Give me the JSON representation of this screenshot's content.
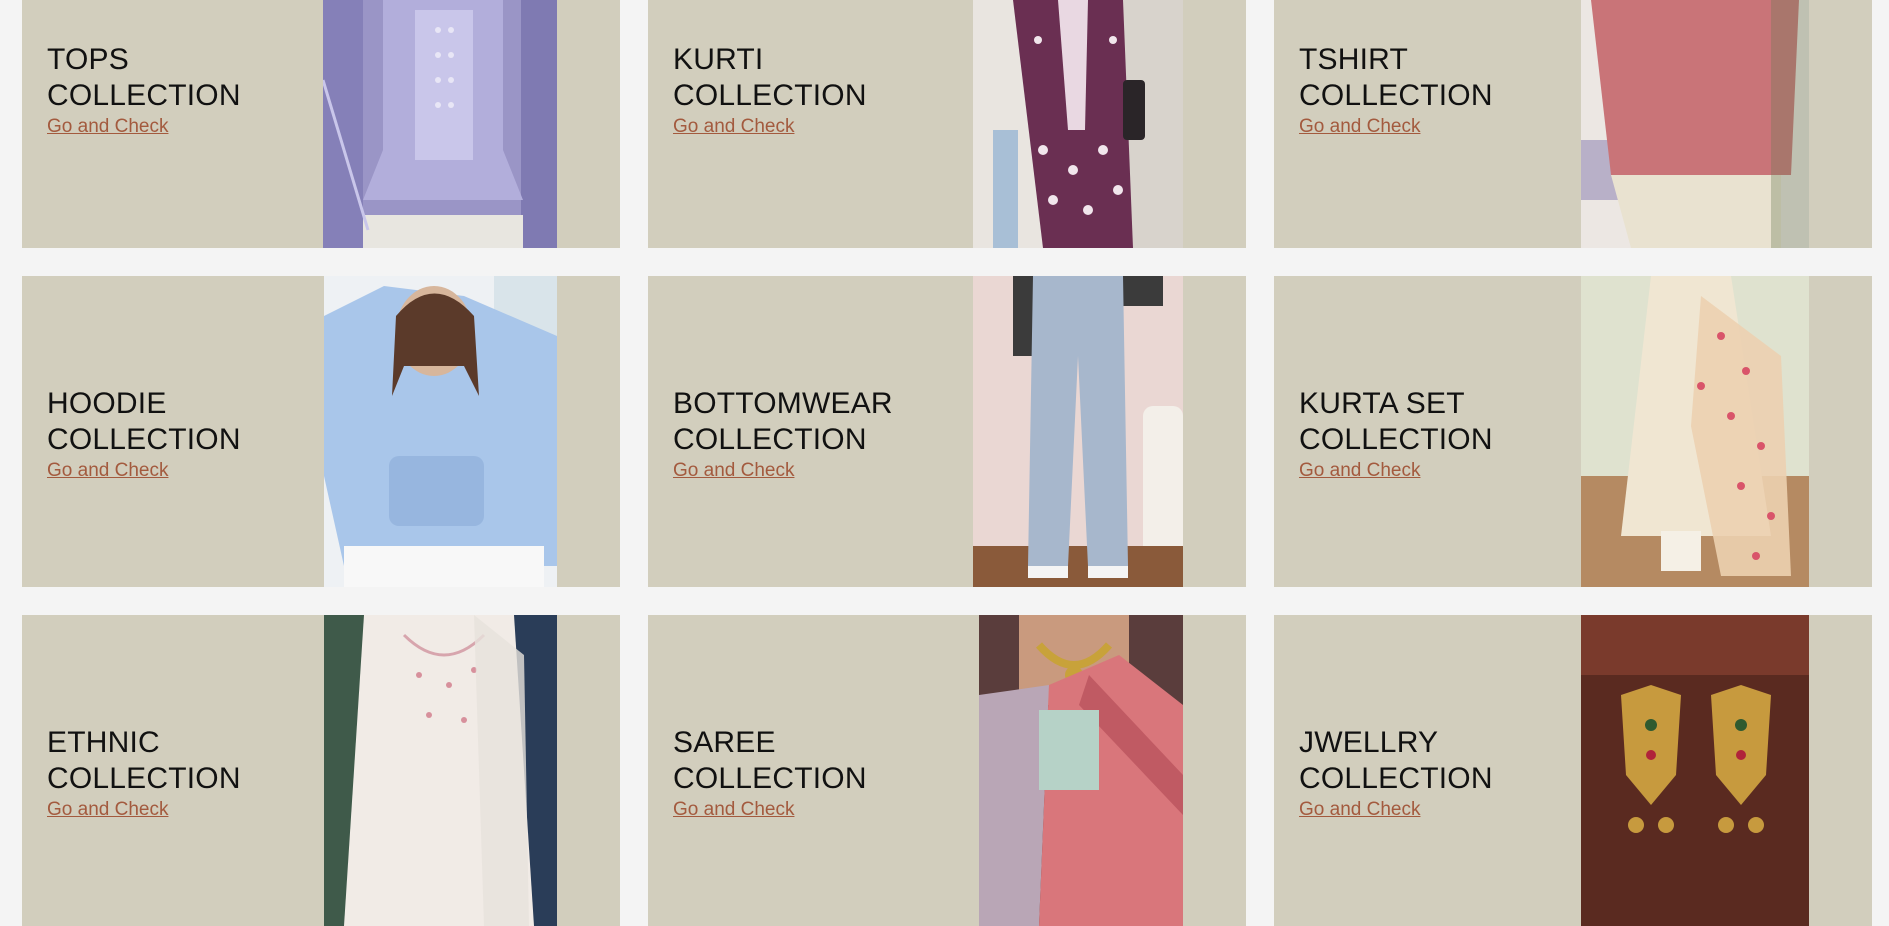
{
  "cards": [
    {
      "line1": "TOPS",
      "line2": "COLLECTION",
      "link": "Go and Check",
      "image": "lavender-embroidered-top"
    },
    {
      "line1": "KURTI",
      "line2": "COLLECTION",
      "link": "Go and Check",
      "image": "purple-chikankari-kurti"
    },
    {
      "line1": "TSHIRT",
      "line2": "COLLECTION",
      "link": "Go and Check",
      "image": "pink-oversized-tshirt"
    },
    {
      "line1": "HOODIE",
      "line2": "COLLECTION",
      "link": "Go and Check",
      "image": "blue-hoodie"
    },
    {
      "line1": "BOTTOMWEAR",
      "line2": "COLLECTION",
      "link": "Go and Check",
      "image": "light-wash-jeans"
    },
    {
      "line1": "KURTA SET",
      "line2": "COLLECTION",
      "link": "Go and Check",
      "image": "cream-kurta-set"
    },
    {
      "line1": "ETHNIC",
      "line2": "COLLECTION",
      "link": "Go and Check",
      "image": "white-ethnic-dress"
    },
    {
      "line1": "SAREE",
      "line2": "COLLECTION",
      "link": "Go and Check",
      "image": "pink-saree"
    },
    {
      "line1": "JWELLRY",
      "line2": "COLLECTION",
      "link": "Go and Check",
      "image": "gold-earrings"
    }
  ],
  "colors": {
    "card_bg": "#d2cebd",
    "page_bg": "#f4f4f4",
    "link": "#a35a3e",
    "title": "#111111"
  }
}
